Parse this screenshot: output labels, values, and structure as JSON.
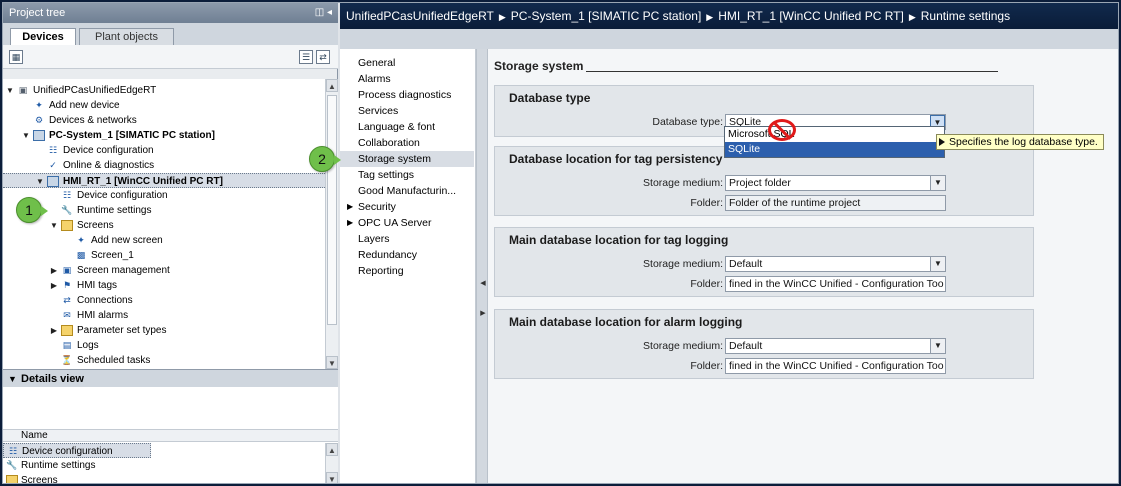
{
  "project_tree": {
    "title": "Project tree",
    "tabs": [
      "Devices",
      "Plant objects"
    ],
    "items": [
      {
        "label": "UnifiedPCasUnifiedEdgeRT"
      },
      {
        "label": "Add new device"
      },
      {
        "label": "Devices & networks"
      },
      {
        "label": "PC-System_1 [SIMATIC PC station]"
      },
      {
        "label": "Device configuration"
      },
      {
        "label": "Online & diagnostics"
      },
      {
        "label": "HMI_RT_1 [WinCC Unified PC RT]"
      },
      {
        "label": "Device configuration"
      },
      {
        "label": "Runtime settings"
      },
      {
        "label": "Screens"
      },
      {
        "label": "Add new screen"
      },
      {
        "label": "Screen_1"
      },
      {
        "label": "Screen management"
      },
      {
        "label": "HMI tags"
      },
      {
        "label": "Connections"
      },
      {
        "label": "HMI alarms"
      },
      {
        "label": "Parameter set types"
      },
      {
        "label": "Logs"
      },
      {
        "label": "Scheduled tasks"
      }
    ]
  },
  "details_view": {
    "title": "Details view",
    "column": "Name",
    "rows": [
      {
        "label": "Device configuration"
      },
      {
        "label": "Runtime settings"
      },
      {
        "label": "Screens"
      }
    ]
  },
  "breadcrumb": [
    "UnifiedPCasUnifiedEdgeRT",
    "PC-System_1 [SIMATIC PC station]",
    "HMI_RT_1 [WinCC Unified PC RT]",
    "Runtime settings"
  ],
  "settings_nav": [
    {
      "label": "General"
    },
    {
      "label": "Alarms"
    },
    {
      "label": "Process diagnostics"
    },
    {
      "label": "Services"
    },
    {
      "label": "Language & font"
    },
    {
      "label": "Collaboration"
    },
    {
      "label": "Storage system"
    },
    {
      "label": "Tag settings"
    },
    {
      "label": "Good Manufacturin..."
    },
    {
      "label": "Security"
    },
    {
      "label": "OPC UA Server"
    },
    {
      "label": "Layers"
    },
    {
      "label": "Redundancy"
    },
    {
      "label": "Reporting"
    }
  ],
  "storage": {
    "section_title": "Storage system",
    "database_type": {
      "group_title": "Database type",
      "label": "Database type:",
      "value": "SQLite",
      "options": [
        "Microsoft SQL",
        "SQLite"
      ],
      "tooltip": "Specifies the log database type."
    },
    "tag_persistency": {
      "group_title": "Database location for tag persistency",
      "medium_label": "Storage medium:",
      "medium_value": "Project folder",
      "folder_label": "Folder:",
      "folder_value": "Folder of the runtime project"
    },
    "tag_logging": {
      "group_title": "Main database location for tag logging",
      "medium_label": "Storage medium:",
      "medium_value": "Default",
      "folder_label": "Folder:",
      "folder_value": "fined in the WinCC Unified - Configuration Too"
    },
    "alarm_logging": {
      "group_title": "Main database location for alarm logging",
      "medium_label": "Storage medium:",
      "medium_value": "Default",
      "folder_label": "Folder:",
      "folder_value": "fined in the WinCC Unified - Configuration Too"
    }
  },
  "callouts": [
    "1",
    "2"
  ],
  "colors": {
    "callout": "#6fbf4a",
    "selection": "#2c5fad",
    "tooltip": "#ffffc6",
    "stop": "#e01919"
  }
}
